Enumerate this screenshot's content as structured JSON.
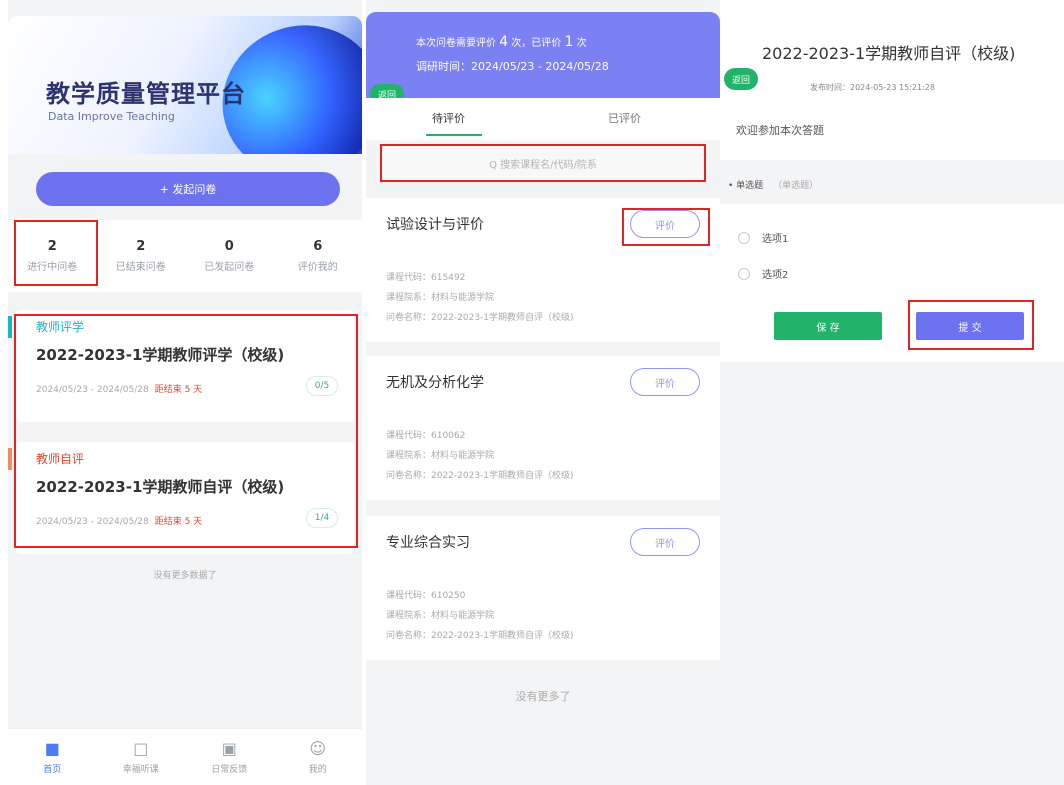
{
  "home": {
    "app_title": "教学质量管理平台",
    "app_subtitle": "Data Improve Teaching",
    "launch_button": "+ 发起问卷",
    "stats": [
      {
        "value": "2",
        "label": "进行中问卷"
      },
      {
        "value": "2",
        "label": "已结束问卷"
      },
      {
        "value": "0",
        "label": "已发起问卷"
      },
      {
        "value": "6",
        "label": "评价我的"
      }
    ],
    "cards": [
      {
        "tag": "教师评学",
        "tag_color": "#19b6c9",
        "title": "2022-2023-1学期教师评学（校级)",
        "date": "2024/05/23 - 2024/05/28",
        "due": "距结束 5 天",
        "progress": "0/5"
      },
      {
        "tag": "教师自评",
        "tag_color": "#e6452f",
        "title": "2022-2023-1学期教师自评（校级)",
        "date": "2024/05/23 - 2024/05/28",
        "due": "距结束 5 天",
        "progress": "1/4"
      }
    ],
    "no_more": "没有更多数据了",
    "tabbar": [
      {
        "icon": "home-icon",
        "label": "首页",
        "active": true
      },
      {
        "icon": "chat-icon",
        "label": "幸福听课"
      },
      {
        "icon": "feedback-icon",
        "label": "日常反馈"
      },
      {
        "icon": "user-icon",
        "label": "我的"
      }
    ]
  },
  "evaluate": {
    "summary_prefix": "本次问卷需要评价",
    "summary_total": "4",
    "summary_mid": "次，已评价",
    "summary_done": "1",
    "summary_suffix": "次",
    "time_range": "调研时间：2024/05/23 - 2024/05/28",
    "back_label": "返回",
    "tabs": [
      "待评价",
      "已评价"
    ],
    "search_placeholder": "Q 搜索课程名/代码/院系",
    "courses": [
      {
        "name": "试验设计与评价",
        "code": "课程代码：615492",
        "dept": "课程院系：材料与能源学院",
        "survey": "问卷名称：2022-2023-1学期教师自评（校级)",
        "button": "评价"
      },
      {
        "name": "无机及分析化学",
        "code": "课程代码：610062",
        "dept": "课程院系：材料与能源学院",
        "survey": "问卷名称：2022-2023-1学期教师自评（校级)",
        "button": "评价"
      },
      {
        "name": "专业综合实习",
        "code": "课程代码：610250",
        "dept": "课程院系：材料与能源学院",
        "survey": "问卷名称：2022-2023-1学期教师自评（校级)",
        "button": "评价"
      }
    ],
    "no_more": "没有更多了"
  },
  "survey": {
    "title": "2022-2023-1学期教师自评（校级)",
    "back_label": "返回",
    "publish_time": "发布时间：2024-05-23 15:21:28",
    "welcome": "欢迎参加本次答题",
    "question_type": "• 单选题",
    "question_hint": "（单选题）",
    "options": [
      "选项1",
      "选项2"
    ],
    "save": "保 存",
    "submit": "提 交"
  },
  "colors": {
    "primary": "#6c72f0",
    "green": "#22b36b",
    "highlight": "#e02424"
  }
}
